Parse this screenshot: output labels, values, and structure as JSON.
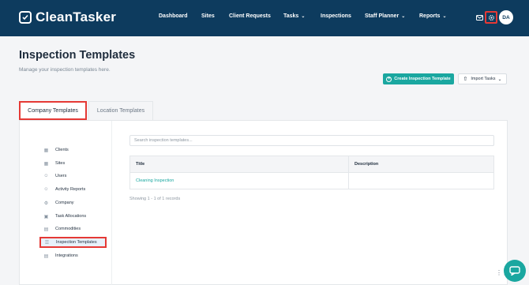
{
  "brand": {
    "name": "CleanTasker"
  },
  "nav": {
    "items": [
      {
        "label": "Dashboard",
        "dropdown": false
      },
      {
        "label": "Sites",
        "dropdown": false
      },
      {
        "label": "Client Requests",
        "dropdown": false
      },
      {
        "label": "Tasks",
        "dropdown": true
      },
      {
        "label": "Inspections",
        "dropdown": false
      },
      {
        "label": "Staff Planner",
        "dropdown": true
      },
      {
        "label": "Reports",
        "dropdown": true
      }
    ],
    "icons": [
      "mail-icon",
      "gear-icon"
    ],
    "avatar_initials": "DA"
  },
  "page": {
    "title": "Inspection Templates",
    "subtitle": "Manage your inspection templates here."
  },
  "actions": {
    "create_label": "Create Inspection Template",
    "import_label": "Import Tasks"
  },
  "tabs": [
    {
      "label": "Company Templates",
      "active": true
    },
    {
      "label": "Location Templates",
      "active": false
    }
  ],
  "sidebar": {
    "items": [
      {
        "label": "Clients",
        "icon": "building-icon"
      },
      {
        "label": "Sites",
        "icon": "building-icon"
      },
      {
        "label": "Users",
        "icon": "users-icon"
      },
      {
        "label": "Activity Reports",
        "icon": "user-activity-icon"
      },
      {
        "label": "Company",
        "icon": "gear-icon"
      },
      {
        "label": "Task Allocations",
        "icon": "calendar-icon"
      },
      {
        "label": "Commodities",
        "icon": "document-icon"
      },
      {
        "label": "Inspection Templates",
        "icon": "checklist-icon",
        "active": true
      },
      {
        "label": "Integrations",
        "icon": "document-icon"
      }
    ]
  },
  "search": {
    "placeholder": "Search inspection templates...",
    "value": ""
  },
  "table": {
    "headers": [
      "Title",
      "Description"
    ],
    "rows": [
      {
        "title": "Cleaning Inspection",
        "description": ""
      }
    ]
  },
  "records_text": "Showing 1 - 1 of 1 records",
  "colors": {
    "nav_bg": "#0d3b5e",
    "accent": "#1aa7a0",
    "highlight": "#e53935"
  }
}
